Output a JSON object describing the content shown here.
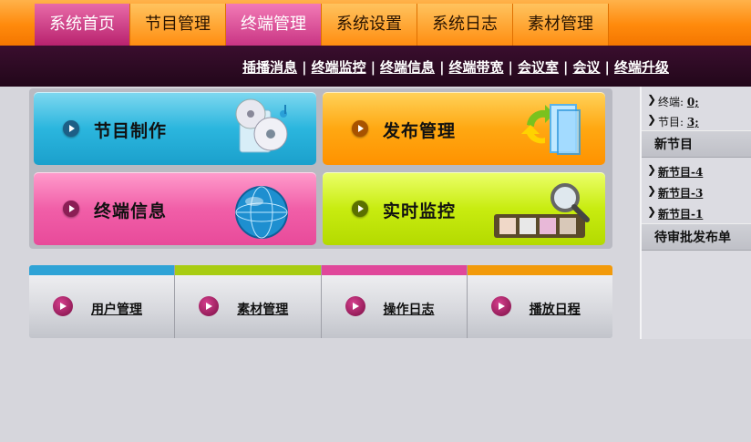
{
  "nav": {
    "tabs": [
      {
        "label": "系统首页",
        "state": "active"
      },
      {
        "label": "节目管理",
        "state": "normal"
      },
      {
        "label": "终端管理",
        "state": "current"
      },
      {
        "label": "系统设置",
        "state": "normal"
      },
      {
        "label": "系统日志",
        "state": "normal"
      },
      {
        "label": "素材管理",
        "state": "normal"
      }
    ]
  },
  "subnav": {
    "links": [
      "插播消息",
      "终端监控",
      "终端信息",
      "终端带宽",
      "会议室",
      "会议",
      "终端升级"
    ],
    "separator": "|"
  },
  "tiles": [
    {
      "label": "节目制作",
      "icon": "disc-media-icon"
    },
    {
      "label": "发布管理",
      "icon": "publish-arrows-icon"
    },
    {
      "label": "终端信息",
      "icon": "globe-icon"
    },
    {
      "label": "实时监控",
      "icon": "film-magnifier-icon"
    }
  ],
  "quick": [
    {
      "label": "用户管理",
      "strip": "#2fa3d6"
    },
    {
      "label": "素材管理",
      "strip": "#a8cc12"
    },
    {
      "label": "操作日志",
      "strip": "#e0479a"
    },
    {
      "label": "播放日程",
      "strip": "#f29a0a"
    }
  ],
  "sidebar": {
    "stats": [
      {
        "label": "终端:",
        "value": "0;"
      },
      {
        "label": "节目:",
        "value": "3;"
      }
    ],
    "new_programs_title": "新节目",
    "new_programs": [
      "新节目-4",
      "新节目-3",
      "新节目-1"
    ],
    "pending_title": "待审批发布单"
  },
  "colors": {
    "nav_orange": "#ff8a0c",
    "nav_active": "#c93584",
    "subbar": "#2a0a22",
    "page_bg": "#d6d6dc"
  }
}
